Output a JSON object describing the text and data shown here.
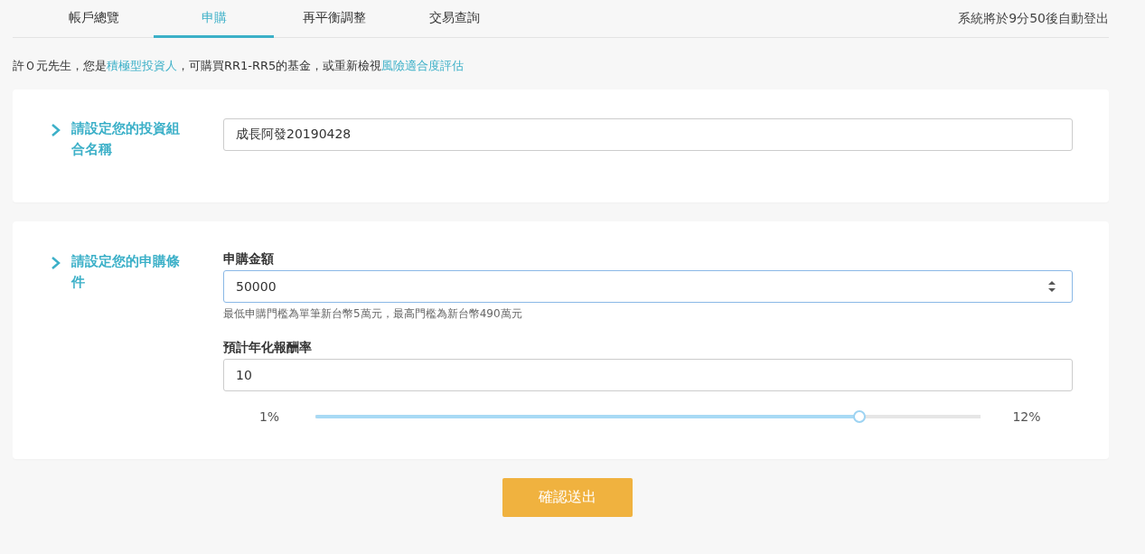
{
  "tabs": [
    {
      "label": "帳戶總覽",
      "selected": false
    },
    {
      "label": "申購",
      "selected": true
    },
    {
      "label": "再平衡調整",
      "selected": false
    },
    {
      "label": "交易查詢",
      "selected": false
    }
  ],
  "logout_notice": "系統將於9分50後自動登出",
  "greeting": [
    {
      "kind": "text",
      "text": "許Ｏ元先生，您是"
    },
    {
      "kind": "link",
      "text": "積極型投資人"
    },
    {
      "kind": "text",
      "text": "，可購買RR1-RR5的基金，或重新檢視"
    },
    {
      "kind": "link",
      "text": "風險適合度評估"
    }
  ],
  "portfolio_section": {
    "title": "請設定您的投資組合名稱",
    "name_value": "成長阿發20190428"
  },
  "purchase_section": {
    "title": "請設定您的申購條件",
    "amount": {
      "label": "申購金額",
      "value": "50000",
      "focused": true,
      "hint": "最低申購門檻為單筆新台幣5萬元，最高門檻為新台幣490萬元"
    },
    "return_rate": {
      "label": "預計年化報酬率",
      "value": "10",
      "min_label": "1%",
      "max_label": "12%",
      "level": 0.818
    }
  },
  "submit_button": "確認送出"
}
